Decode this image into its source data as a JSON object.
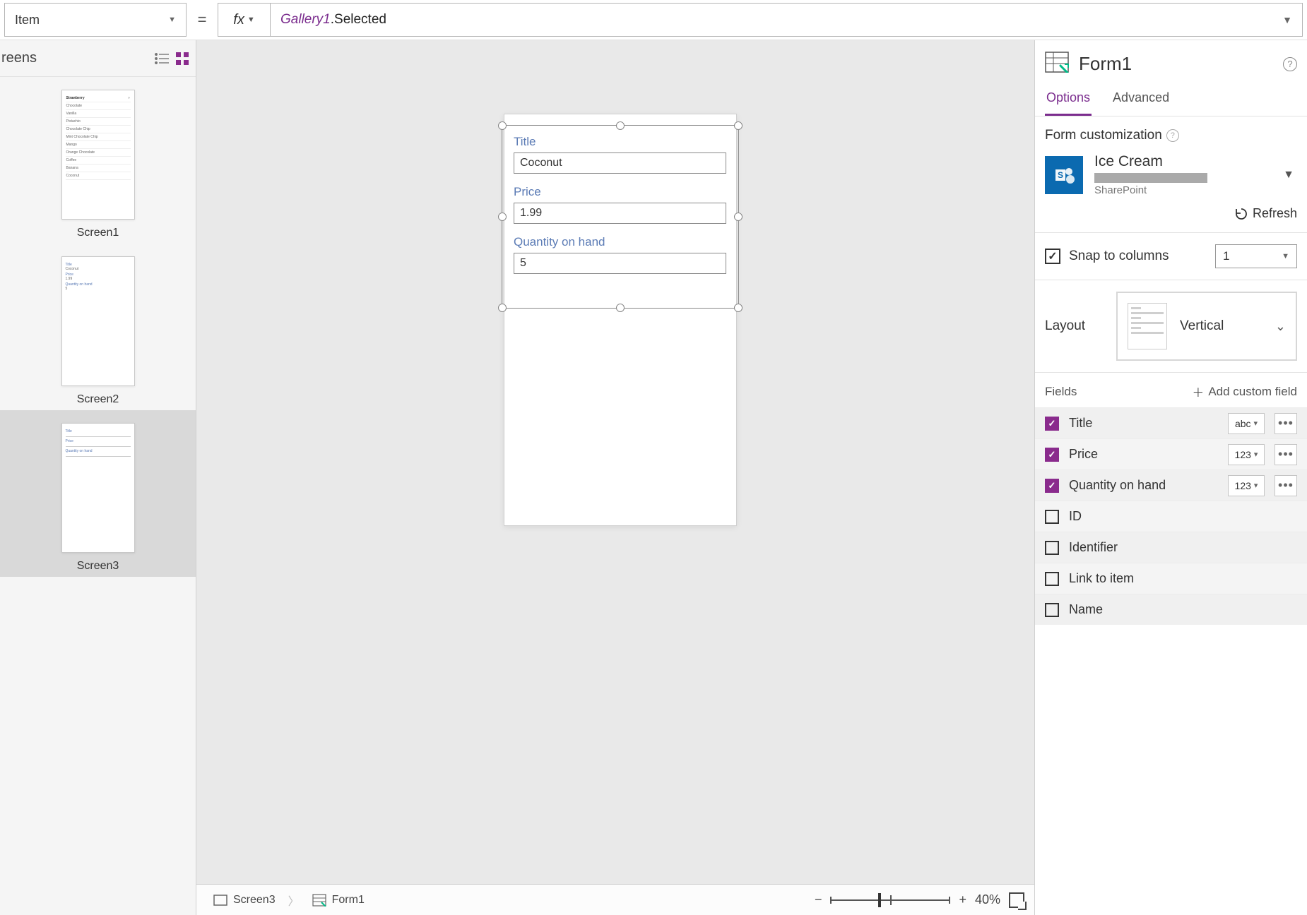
{
  "formula": {
    "property": "Item",
    "fx": "fx",
    "ref": "Gallery1",
    "suffix": ".Selected"
  },
  "tree": {
    "header": "reens",
    "screens": [
      {
        "label": "Screen1"
      },
      {
        "label": "Screen2"
      },
      {
        "label": "Screen3"
      }
    ],
    "thumb1_items": [
      "Strawberry",
      "Chocolate",
      "Vanilla",
      "Pistachio",
      "Chocolate Chip",
      "Mint Chocolate Chip",
      "Mango",
      "Orange Chocolate",
      "Coffee",
      "Banana",
      "Coconut"
    ],
    "thumb2": {
      "f1": "Title",
      "v1": "Coconut",
      "f2": "Price",
      "v2": "1.99",
      "f3": "Quantity on hand",
      "v3": "5"
    }
  },
  "canvas": {
    "fields": [
      {
        "label": "Title",
        "value": "Coconut"
      },
      {
        "label": "Price",
        "value": "1.99"
      },
      {
        "label": "Quantity on hand",
        "value": "5"
      }
    ]
  },
  "breadcrumb": {
    "screen": "Screen3",
    "form": "Form1"
  },
  "zoom": {
    "pct": "40%"
  },
  "props": {
    "title": "Form1",
    "tabs": {
      "options": "Options",
      "advanced": "Advanced"
    },
    "customization": "Form customization",
    "datasource": {
      "name": "Ice Cream",
      "provider": "SharePoint"
    },
    "refresh": "Refresh",
    "snap": {
      "label": "Snap to columns",
      "value": "1"
    },
    "layout": {
      "label": "Layout",
      "value": "Vertical"
    },
    "fields": {
      "label": "Fields",
      "add": "Add custom field",
      "rows": [
        {
          "checked": true,
          "name": "Title",
          "type": "abc"
        },
        {
          "checked": true,
          "name": "Price",
          "type": "123"
        },
        {
          "checked": true,
          "name": "Quantity on hand",
          "type": "123"
        },
        {
          "checked": false,
          "name": "ID",
          "type": null
        },
        {
          "checked": false,
          "name": "Identifier",
          "type": null
        },
        {
          "checked": false,
          "name": "Link to item",
          "type": null
        },
        {
          "checked": false,
          "name": "Name",
          "type": null
        }
      ]
    }
  }
}
